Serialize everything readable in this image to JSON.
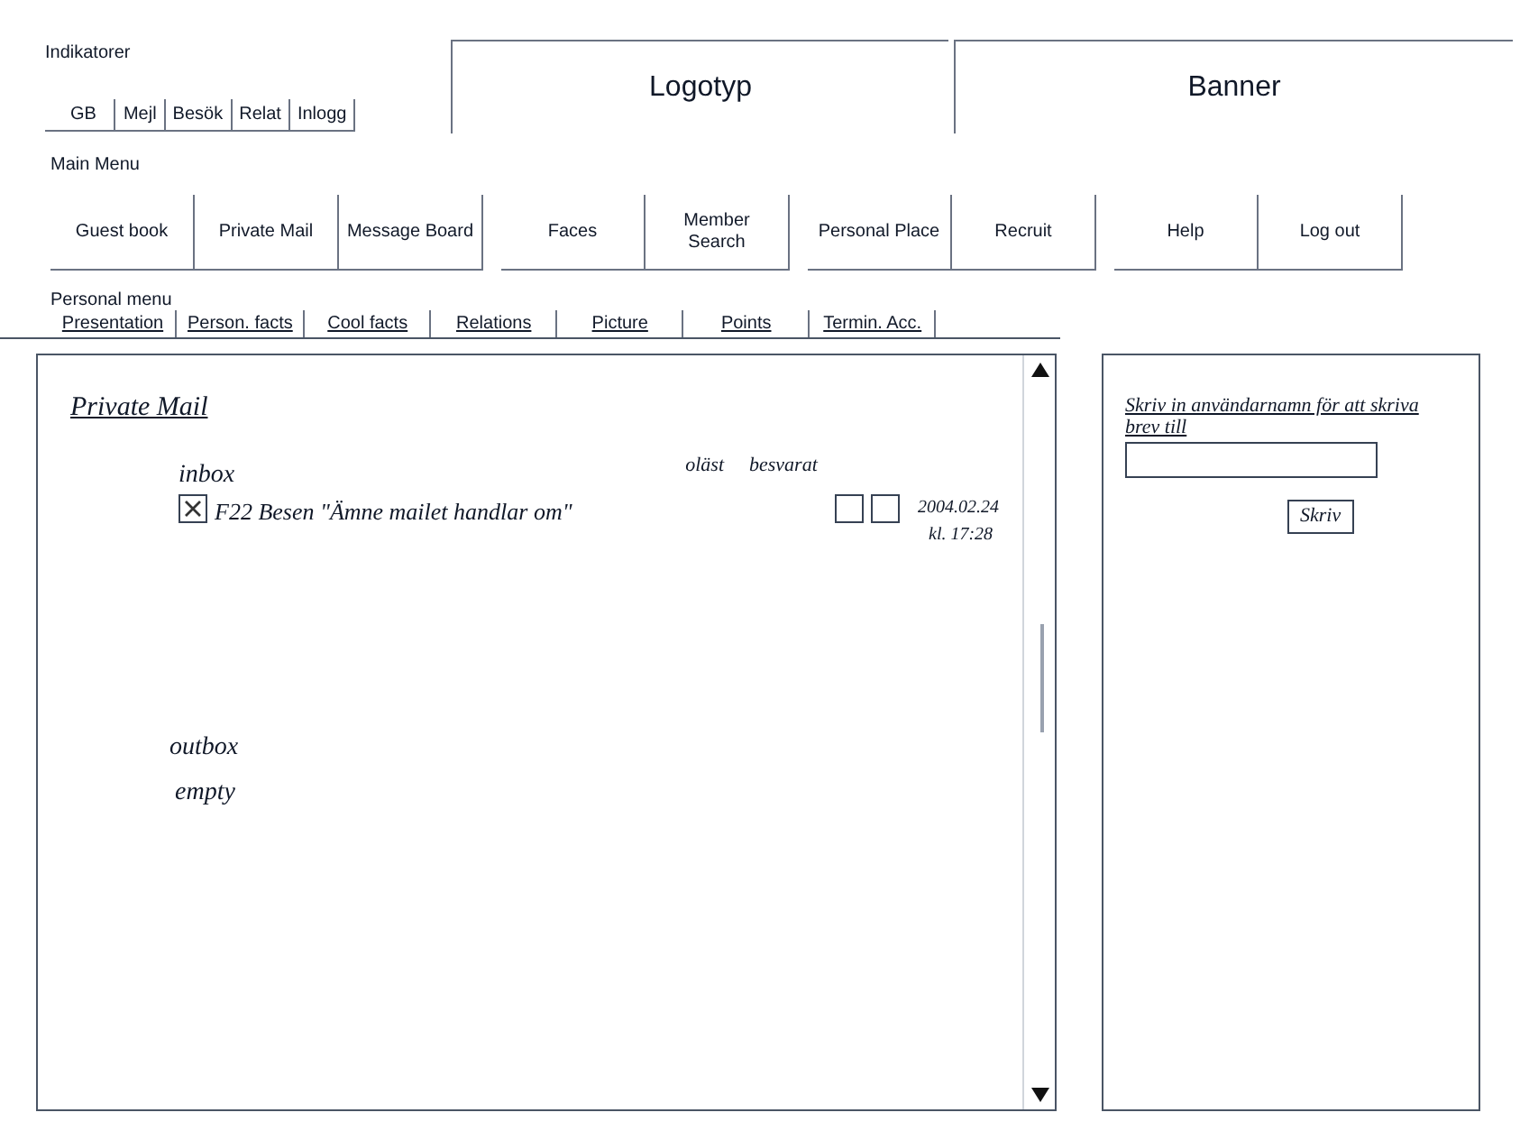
{
  "indicators": {
    "label": "Indikatorer",
    "buttons": [
      "GB",
      "Mejl",
      "Besök",
      "Relat",
      "Inlogg"
    ]
  },
  "logo": "Logotyp",
  "banner": "Banner",
  "main_menu": {
    "label": "Main Menu",
    "items": [
      "Guest book",
      "Private Mail",
      "Message Board",
      "Faces",
      "Member Search",
      "Personal Place",
      "Recruit",
      "Help",
      "Log out"
    ]
  },
  "personal_menu": {
    "label": "Personal menu",
    "items": [
      "Presentation",
      "Person. facts",
      "Cool facts",
      "Relations",
      "Picture",
      "Points",
      "Termin. Acc."
    ]
  },
  "mail_panel": {
    "title": "Private Mail",
    "inbox": {
      "label": "inbox",
      "column_labels": [
        "oläst",
        "besvarat"
      ],
      "messages": [
        {
          "checked": true,
          "text": "F22 Besen \"Ämne mailet handlar om\"",
          "unread": false,
          "answered": false,
          "date": "2004.02.24",
          "time": "kl. 17:28"
        }
      ]
    },
    "outbox": {
      "label": "outbox",
      "status": "empty"
    }
  },
  "write_panel": {
    "instruction": "Skriv in användarnamn för att skriva brev till",
    "button": "Skriv"
  }
}
